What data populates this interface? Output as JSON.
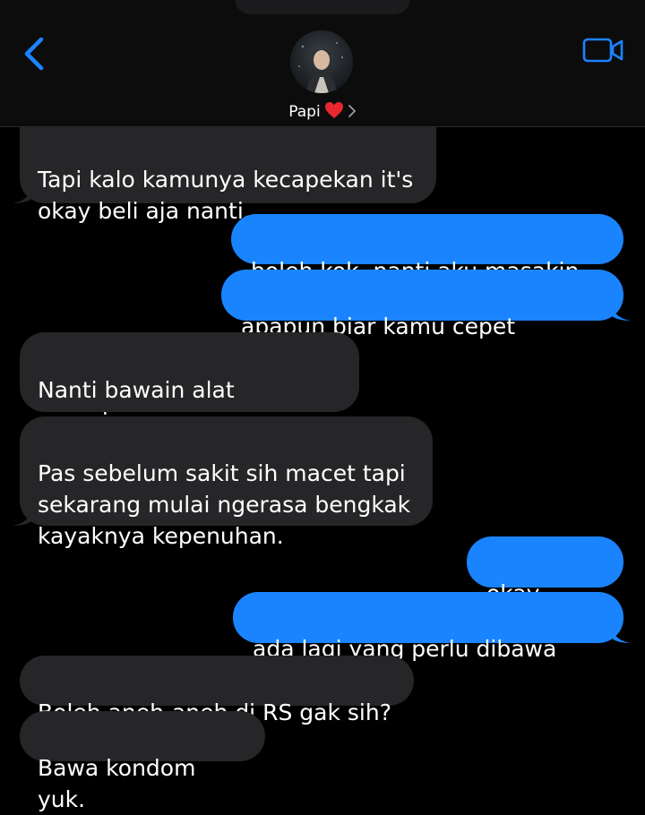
{
  "contact": {
    "name": "Papi"
  },
  "messages": [
    {
      "direction": "received",
      "text": "Tapi kalo kamunya kecapekan it's\nokay beli aja nanti."
    },
    {
      "direction": "sent",
      "text": "boleh kok, nanti aku masakin ya"
    },
    {
      "direction": "sent",
      "text": "apapun biar kamu cepet sembuh"
    },
    {
      "direction": "received",
      "text": "Nanti bawain alat pumping\nsekalian."
    },
    {
      "direction": "received",
      "text": "Pas sebelum sakit sih macet tapi\nsekarang mulai ngerasa bengkak\nkayaknya kepenuhan."
    },
    {
      "direction": "sent",
      "text": "okay noted"
    },
    {
      "direction": "sent",
      "text": "ada lagi yang perlu dibawa gak?"
    },
    {
      "direction": "received",
      "text": "Boleh aneh-aneh di RS gak sih?"
    },
    {
      "direction": "received",
      "text": "Bawa kondom yuk."
    }
  ],
  "colors": {
    "background": "#000000",
    "header": "#0c0c0d",
    "sent_bubble": "#1a84ff",
    "received_bubble": "#262628",
    "accent": "#1a84ff",
    "heart": "#e8282e"
  },
  "icons": {
    "back": "chevron-left-icon",
    "video": "video-camera-icon",
    "heart": "red-heart-icon",
    "disclosure": "chevron-right-icon"
  }
}
